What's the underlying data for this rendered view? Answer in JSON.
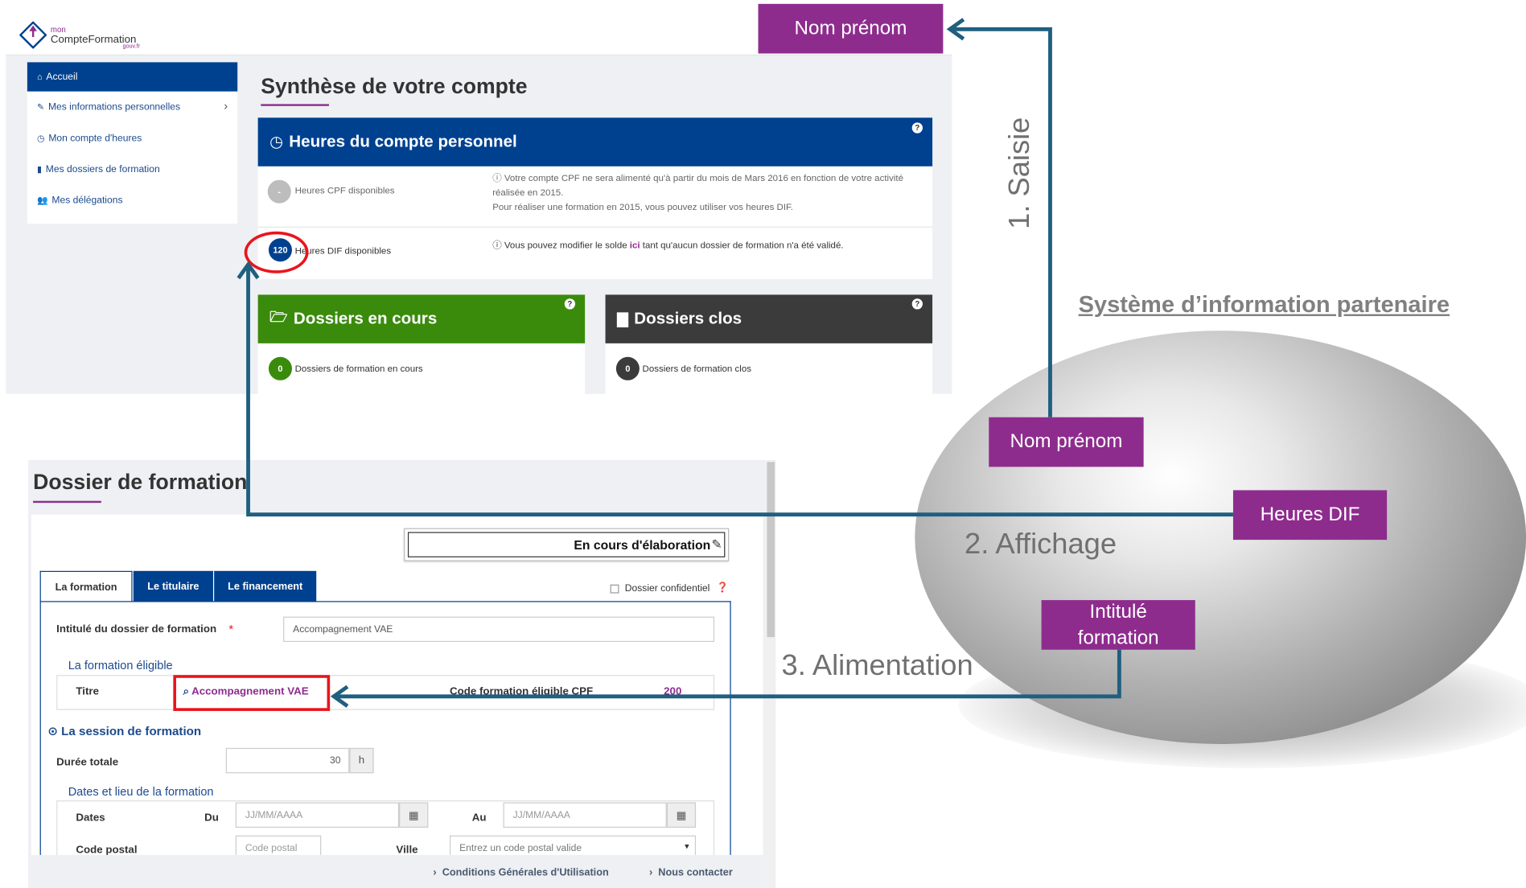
{
  "logo": {
    "small": "mon",
    "main": "CompteFormation",
    "tagline": "gouv.fr"
  },
  "sidebar": {
    "items": [
      {
        "label": "Accueil",
        "icon": "home-icon"
      },
      {
        "label": "Mes informations personnelles",
        "icon": "pencil-icon"
      },
      {
        "label": "Mon compte d'heures",
        "icon": "clock-icon"
      },
      {
        "label": "Mes dossiers de formation",
        "icon": "book-icon"
      },
      {
        "label": "Mes délégations",
        "icon": "users-icon"
      }
    ]
  },
  "synthese": {
    "title": "Synthèse de votre compte",
    "heures_box": {
      "title": "Heures du compte personnel",
      "cpf_value": "-",
      "cpf_label": "Heures CPF disponibles",
      "cpf_info_line1": "Votre compte CPF ne sera alimenté qu'à partir du mois de Mars 2016 en fonction de votre activité",
      "cpf_info_line2": "réalisée en 2015.",
      "cpf_info_line3": "Pour réaliser une formation en 2015, vous pouvez utiliser vos heures DIF.",
      "dif_value": "120",
      "dif_label": "Heures DIF disponibles",
      "dif_info_pre": "Vous pouvez modifier le solde ",
      "dif_info_link": "ici",
      "dif_info_post": " tant qu'aucun dossier de formation n'a été validé."
    },
    "dossiers_en_cours": {
      "title": "Dossiers en cours",
      "count": "0",
      "label": "Dossiers de formation en cours"
    },
    "dossiers_clos": {
      "title": "Dossiers clos",
      "count": "0",
      "label": "Dossiers de formation clos"
    }
  },
  "dossier": {
    "title": "Dossier de formation",
    "status": "En cours d'élaboration",
    "tabs": [
      "La formation",
      "Le titulaire",
      "Le financement"
    ],
    "confidential_label": "Dossier confidentiel",
    "intitule_label": "Intitulé du dossier de formation",
    "required_mark": "*",
    "intitule_value": "Accompagnement VAE",
    "formation_eligible_label": "La formation éligible",
    "titre_label": "Titre",
    "titre_value": "Accompagnement VAE",
    "code_label": "Code formation éligible CPF",
    "code_value": "200",
    "session_label": "La session de formation",
    "duree_label": "Durée totale",
    "duree_value": "30",
    "duree_unit": "h",
    "dates_lieu_label": "Dates et lieu de la formation",
    "dates_label": "Dates",
    "du_label": "Du",
    "au_label": "Au",
    "date_placeholder": "JJ/MM/AAAA",
    "code_postal_label": "Code postal",
    "code_postal_placeholder": "Code postal",
    "ville_label": "Ville",
    "ville_placeholder": "Entrez un code postal valide",
    "footer_cgu": "Conditions Générales d'Utilisation",
    "footer_contact": "Nous contacter"
  },
  "diagram": {
    "system_title": "Système d’information partenaire",
    "tag_nom_top": "Nom prénom",
    "tag_nom": "Nom prénom",
    "tag_heures": "Heures DIF",
    "tag_intitule_line1": "Intitulé",
    "tag_intitule_line2": "formation",
    "step1": "1. Saisie",
    "step2": "2. Affichage",
    "step3": "3. Alimentation"
  },
  "colors": {
    "purple": "#8e2c8e",
    "navy": "#00418f",
    "green": "#3a8b0c",
    "dark": "#3b3b3b",
    "arrow": "#1f5f7f",
    "highlight": "#e8151b"
  }
}
